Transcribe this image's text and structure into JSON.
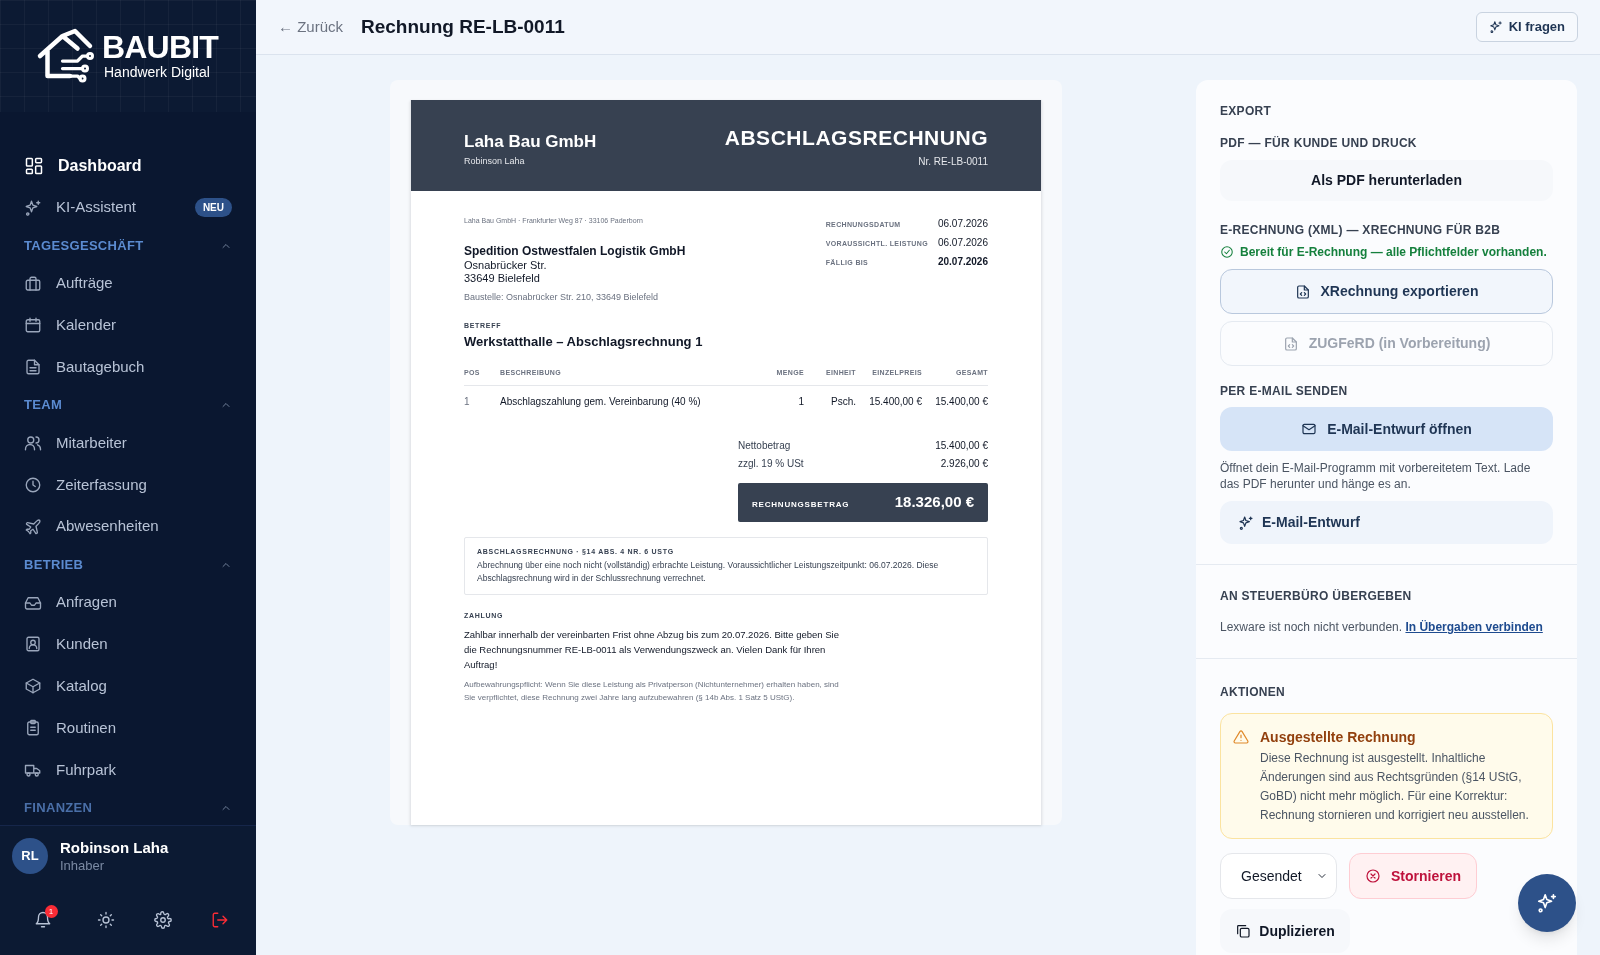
{
  "sidebar": {
    "logo": {
      "name": "BAUBIT",
      "tagline": "Handwerk Digital"
    },
    "top_items": [
      {
        "label": "Dashboard",
        "selected": true
      },
      {
        "label": "KI-Assistent",
        "selected": false,
        "badge": "NEU"
      }
    ],
    "sections": [
      {
        "title": "TAGESGESCHÄFT",
        "expanded": true,
        "items": [
          {
            "label": "Aufträge",
            "selected": false
          },
          {
            "label": "Kalender",
            "selected": false
          },
          {
            "label": "Bautagebuch",
            "selected": false
          }
        ]
      },
      {
        "title": "TEAM",
        "expanded": true,
        "items": [
          {
            "label": "Mitarbeiter",
            "selected": false
          },
          {
            "label": "Zeiterfassung",
            "selected": false
          },
          {
            "label": "Abwesenheiten",
            "selected": false
          }
        ]
      },
      {
        "title": "BETRIEB",
        "expanded": true,
        "items": [
          {
            "label": "Anfragen",
            "selected": false
          },
          {
            "label": "Kunden",
            "selected": false
          },
          {
            "label": "Katalog",
            "selected": false
          },
          {
            "label": "Routinen",
            "selected": false
          },
          {
            "label": "Fuhrpark",
            "selected": false
          }
        ]
      },
      {
        "title": "FINANZEN",
        "expanded": true
      }
    ],
    "user": {
      "initials": "RL",
      "name": "Robinson Laha",
      "role": "Inhaber"
    },
    "notification_count": "1"
  },
  "header": {
    "back": "← Zurück",
    "title": "Rechnung RE-LB-0011",
    "ai_button": "KI fragen"
  },
  "invoice": {
    "company": "Laha Bau GmbH",
    "person": "Robinson Laha",
    "doc_title": "ABSCHLAGSRECHNUNG",
    "number": "Nr. RE-LB-0011",
    "sender_line": "Laha Bau GmbH · Frankfurter Weg 87 · 33106 Paderborn",
    "recipient": {
      "name": "Spedition Ostwestfalen Logistik GmbH",
      "street": "Osnabrücker Str.",
      "city": "33649 Bielefeld"
    },
    "site": "Baustelle: Osnabrücker Str. 210, 33649 Bielefeld",
    "meta": [
      {
        "label": "RECHNUNGSDATUM",
        "value": "06.07.2026",
        "emphasis": false
      },
      {
        "label": "VORAUSSICHTL. LEISTUNG",
        "value": "06.07.2026",
        "emphasis": false
      },
      {
        "label": "FÄLLIG BIS",
        "value": "20.07.2026",
        "emphasis": true
      }
    ],
    "subject_label": "BETREFF",
    "subject": "Werkstatthalle – Abschlagsrechnung 1",
    "columns": [
      "POS",
      "BESCHREIBUNG",
      "MENGE",
      "EINHEIT",
      "EINZELPREIS",
      "GESAMT"
    ],
    "rows": [
      [
        "1",
        "Abschlagszahlung gem. Vereinbarung (40 %)",
        "1",
        "Psch.",
        "15.400,00 €",
        "15.400,00 €"
      ]
    ],
    "subtotals": [
      {
        "label": "Nettobetrag",
        "value": "15.400,00 €"
      },
      {
        "label": "zzgl. 19 % USt",
        "value": "2.926,00 €"
      }
    ],
    "total": {
      "label": "RECHNUNGSBETRAG",
      "value": "18.326,00 €"
    },
    "notice": {
      "title": "ABSCHLAGSRECHNUNG · §14 ABS. 4 NR. 6 USTG",
      "text": "Abrechnung über eine noch nicht (vollständig) erbrachte Leistung. Voraussichtlicher Leistungszeitpunkt: 06.07.2026. Diese Abschlagsrechnung wird in der Schlussrechnung verrechnet."
    },
    "payment": {
      "title": "ZAHLUNG",
      "text": "Zahlbar innerhalb der vereinbarten Frist ohne Abzug bis zum 20.07.2026. Bitte geben Sie die Rechnungsnummer RE-LB-0011 als Verwendungszweck an. Vielen Dank für Ihren Auftrag!"
    },
    "retention": "Aufbewahrungspflicht: Wenn Sie diese Leistung als Privatperson (Nichtunternehmer) erhalten haben, sind Sie verpflichtet, diese Rechnung zwei Jahre lang aufzubewahren (§ 14b Abs. 1 Satz 5 UStG)."
  },
  "panel": {
    "export": {
      "title": "EXPORT",
      "pdf_label": "PDF — FÜR KUNDE UND DRUCK",
      "pdf_button": "Als PDF herunterladen",
      "xml_label": "E-RECHNUNG (XML) — XRECHNUNG FÜR B2B",
      "ready": "Bereit für E-Rechnung — alle Pflichtfelder vorhanden.",
      "xrechnung_button": {
        "label": "XRechnung exportieren",
        "disabled": false
      },
      "zugferd_button": {
        "label": "ZUGFeRD (in Vorbereitung)",
        "disabled": true
      },
      "mail_label": "PER E-MAIL SENDEN",
      "mail_button": "E-Mail-Entwurf öffnen",
      "mail_hint": "Öffnet dein E-Mail-Programm mit vorbereitetem Text. Lade das PDF herunter und hänge es an.",
      "ai_mail_button": "E-Mail-Entwurf"
    },
    "tax": {
      "title": "AN STEUERBÜRO ÜBERGEBEN",
      "text": "Lexware ist noch nicht verbunden.",
      "link": "In Übergaben verbinden"
    },
    "actions": {
      "title": "AKTIONEN",
      "warning": {
        "title": "Ausgestellte Rechnung",
        "text": "Diese Rechnung ist ausgestellt. Inhaltliche Änderungen sind aus Rechtsgründen (§14 UStG, GoBD) nicht mehr möglich. Für eine Korrektur: Rechnung stornieren und korrigiert neu ausstellen."
      },
      "status": "Gesendet",
      "cancel_button": "Stornieren",
      "duplicate_button": "Duplizieren"
    }
  }
}
